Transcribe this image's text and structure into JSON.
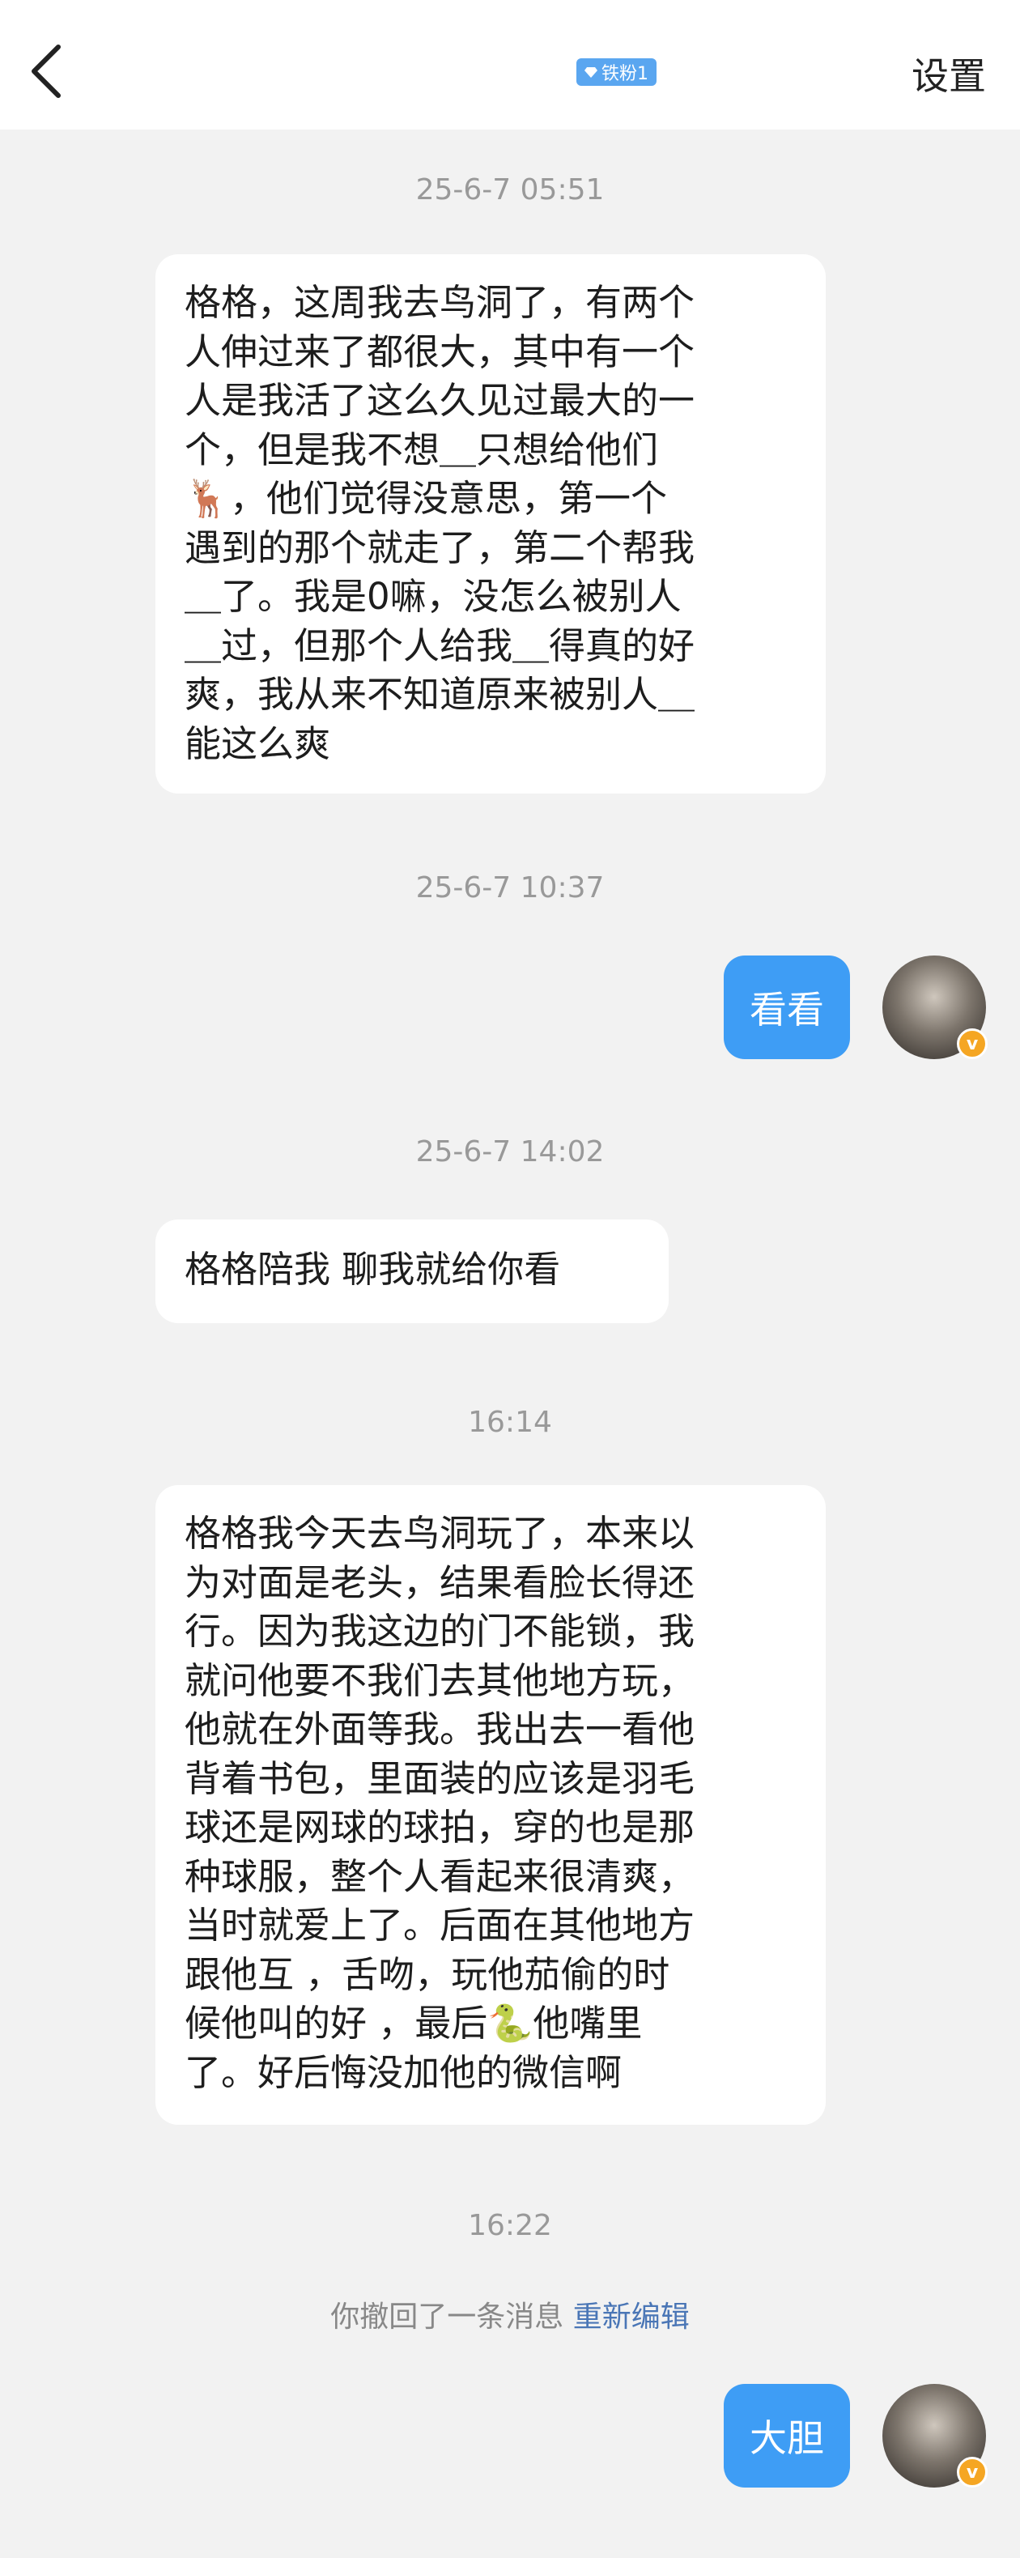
{
  "header": {
    "back_icon": "chevron-left-icon",
    "badge_label": "铁粉1",
    "badge_icon": "diamond-icon",
    "settings_label": "设置"
  },
  "messages": [
    {
      "type": "timestamp",
      "text": "25-6-7 05:51"
    },
    {
      "type": "received",
      "lines": [
        "格格，这周我去鸟洞了，有两个",
        "人伸过来了都很大，其中有一个",
        "人是我活了这么久见过最大的一",
        "个，但是我不想＿只想给他们",
        "🦌，他们觉得没意思，第一个",
        "遇到的那个就走了，第二个帮我",
        "＿了。我是0嘛，没怎么被别人",
        "＿过，但那个人给我＿得真的好",
        "爽，我从来不知道原来被别人＿",
        "能这么爽"
      ]
    },
    {
      "type": "timestamp",
      "text": "25-6-7 10:37"
    },
    {
      "type": "sent",
      "text": "看看"
    },
    {
      "type": "timestamp",
      "text": "25-6-7 14:02"
    },
    {
      "type": "received",
      "lines": [
        "格格陪我 聊我就给你看"
      ]
    },
    {
      "type": "timestamp",
      "text": "16:14"
    },
    {
      "type": "received",
      "lines": [
        "格格我今天去鸟洞玩了，本来以",
        "为对面是老头，结果看脸长得还",
        "行。因为我这边的门不能锁，我",
        "就问他要不我们去其他地方玩，",
        "他就在外面等我。我出去一看他",
        "背着书包，里面装的应该是羽毛",
        "球还是网球的球拍，穿的也是那",
        "种球服，整个人看起来很清爽，",
        "当时就爱上了。后面在其他地方",
        "跟他互 ，舌吻，玩他茄偷的时",
        "候他叫的好 ，最后🐍他嘴里",
        "了。好后悔没加他的微信啊"
      ]
    },
    {
      "type": "timestamp",
      "text": "16:22"
    },
    {
      "type": "system",
      "text": "你撤回了一条消息",
      "action": "重新编辑"
    },
    {
      "type": "sent",
      "text": "大胆"
    }
  ],
  "colors": {
    "sent_bubble": "#3e9df5",
    "background": "#f2f2f2",
    "link": "#4a76b6"
  }
}
